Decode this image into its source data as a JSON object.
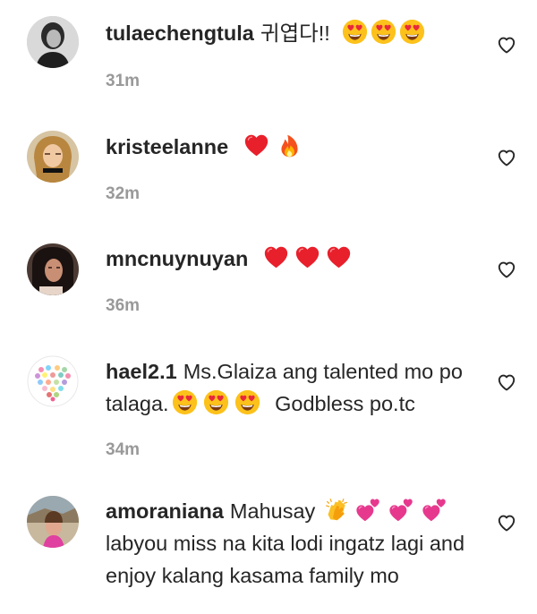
{
  "comments": [
    {
      "username": "tulaechengtula",
      "text": "귀엽다!!",
      "after": "",
      "time": "31m",
      "avatar": "avatar-dark-photo",
      "emojis": [
        "heart-eyes-emoji",
        "heart-eyes-emoji",
        "heart-eyes-emoji"
      ]
    },
    {
      "username": "kristeelanne",
      "text": "",
      "after": "",
      "time": "32m",
      "avatar": "avatar-blonde-photo",
      "emojis": [
        "red-heart-emoji",
        "fire-emoji"
      ]
    },
    {
      "username": "mncnuynuyan",
      "text": "",
      "after": "",
      "time": "36m",
      "avatar": "avatar-dark-hair-photo",
      "emojis": [
        "red-heart-emoji",
        "red-heart-emoji",
        "red-heart-emoji"
      ]
    },
    {
      "username": "hael2.1",
      "text": "Ms.Glaiza ang talented mo po talaga.",
      "after": "Godbless po.tc",
      "time": "34m",
      "avatar": "avatar-heart-collage",
      "emojis": [
        "heart-eyes-emoji",
        "heart-eyes-emoji",
        "heart-eyes-emoji"
      ]
    },
    {
      "username": "amoraniana",
      "text": "Mahusay",
      "after": "labyou miss na kita lodi ingatz lagi and enjoy kalang kasama family mo",
      "time": "",
      "avatar": "avatar-outdoor-photo",
      "emojis": [
        "clapping-hands-emoji",
        "two-hearts-emoji",
        "two-hearts-emoji",
        "two-hearts-emoji"
      ]
    }
  ],
  "colors": {
    "text": "#262626",
    "timestamp": "#999999",
    "like_icon": "#262626"
  },
  "icons": {
    "like": "heart-outline-icon"
  }
}
